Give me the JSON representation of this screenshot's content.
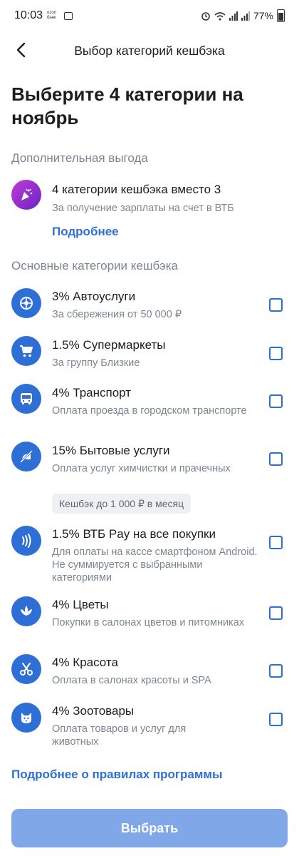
{
  "status_bar": {
    "time": "10:03",
    "ozon_label": "ozon\nбанк",
    "battery": "77%"
  },
  "appbar": {
    "title": "Выбор категорий кешбэка"
  },
  "page_title": "Выберите 4 категории на ноябрь",
  "extra": {
    "section_title": "Дополнительная выгода",
    "item": {
      "icon": "party-popper-icon",
      "title": "4 категории кешбэка вместо 3",
      "subtitle": "За получение зарплаты на счет в ВТБ"
    },
    "more_link": "Подробнее"
  },
  "main": {
    "section_title": "Основные категории кешбэка",
    "items": [
      {
        "icon": "tire-icon",
        "title": "3% Автоуслуги",
        "subtitle": "За сбережения от 50 000 ₽",
        "checked": false
      },
      {
        "icon": "shopping-cart-icon",
        "title": "1.5% Супермаркеты",
        "subtitle": "За группу Близкие",
        "checked": false
      },
      {
        "icon": "bus-icon",
        "title": "4% Транспорт",
        "subtitle": "Оплата проезда в городском транспорте",
        "checked": false
      },
      {
        "icon": "no-iron-icon",
        "title": "15% Бытовые услуги",
        "subtitle": "Оплата услуг химчистки и прачечных",
        "chip": "Кешбэк до 1 000 ₽ в месяц",
        "checked": false
      },
      {
        "icon": "contactless-icon",
        "title": "1.5% ВТБ Pay на все покупки",
        "subtitle": "Для оплаты на кассе смартфоном Android. Не суммируется с выбранными категориями",
        "checked": false
      },
      {
        "icon": "lotus-icon",
        "title": "4% Цветы",
        "subtitle": "Покупки в салонах цветов и питомниках",
        "checked": false
      },
      {
        "icon": "scissors-icon",
        "title": "4% Красота",
        "subtitle": "Оплата в салонах красоты и SPA",
        "checked": false
      },
      {
        "icon": "cat-icon",
        "title": "4% Зоотовары",
        "subtitle": "Оплата товаров и услуг для животных",
        "checked": false
      }
    ]
  },
  "rules_link": "Подробнее о правилах программы",
  "select_button": "Выбрать",
  "colors": {
    "accent": "#2e6fd6",
    "button_disabled": "#80a8e9",
    "secondary_text": "#7b8592"
  }
}
